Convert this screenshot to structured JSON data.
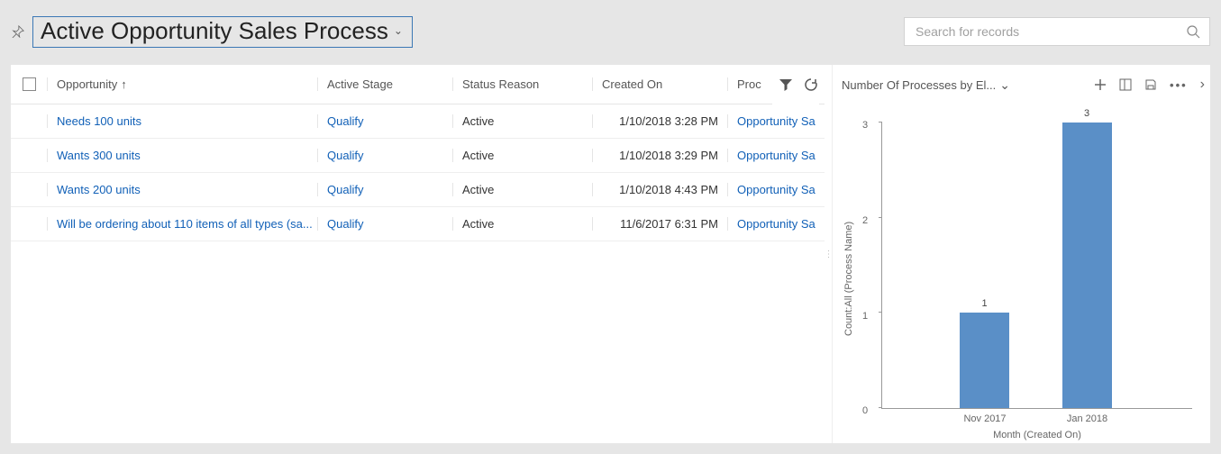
{
  "header": {
    "view_title": "Active Opportunity Sales Process",
    "search_placeholder": "Search for records"
  },
  "grid": {
    "columns": {
      "opportunity": "Opportunity",
      "sort_indicator": "↑",
      "active_stage": "Active Stage",
      "status_reason": "Status Reason",
      "created_on": "Created On",
      "process": "Proc"
    },
    "rows": [
      {
        "opportunity": "Needs 100 units",
        "stage": "Qualify",
        "status": "Active",
        "created": "1/10/2018 3:28 PM",
        "process": "Opportunity Sa"
      },
      {
        "opportunity": "Wants 300 units",
        "stage": "Qualify",
        "status": "Active",
        "created": "1/10/2018 3:29 PM",
        "process": "Opportunity Sa"
      },
      {
        "opportunity": "Wants 200 units",
        "stage": "Qualify",
        "status": "Active",
        "created": "1/10/2018 4:43 PM",
        "process": "Opportunity Sa"
      },
      {
        "opportunity": "Will be ordering about 110 items of all types (sa...",
        "stage": "Qualify",
        "status": "Active",
        "created": "11/6/2017 6:31 PM",
        "process": "Opportunity Sa"
      }
    ]
  },
  "chart_pane": {
    "title": "Number Of Processes by El...",
    "chevron": "⌄"
  },
  "chart_data": {
    "type": "bar",
    "title": "Number Of Processes by El...",
    "categories": [
      "Nov 2017",
      "Jan 2018"
    ],
    "values": [
      1,
      3
    ],
    "yticks": [
      0,
      1,
      2,
      3
    ],
    "xlabel": "Month (Created On)",
    "ylabel": "Count:All (Process Name)",
    "ylim": [
      0,
      3
    ]
  }
}
